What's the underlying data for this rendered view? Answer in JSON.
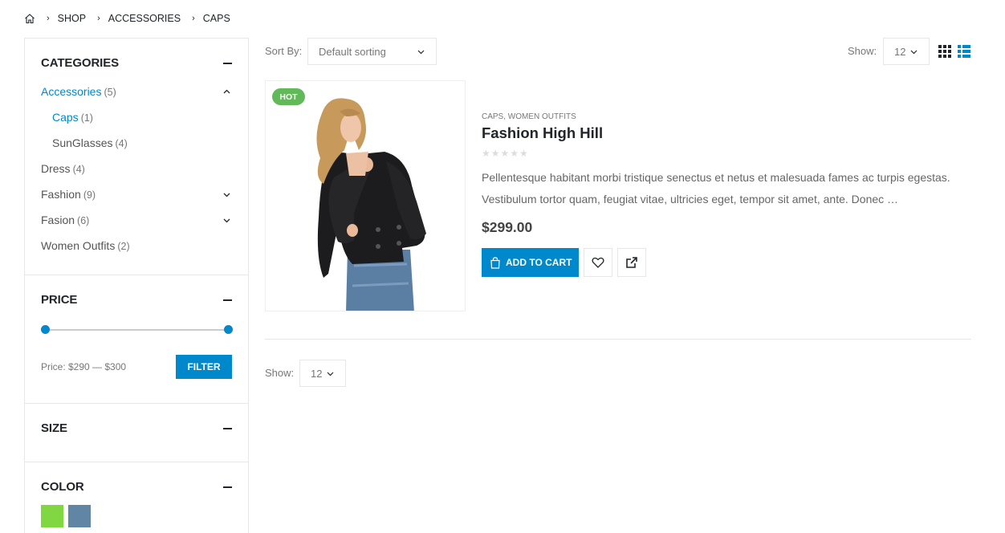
{
  "breadcrumb": {
    "home_icon": "home-icon",
    "items": [
      "SHOP",
      "ACCESSORIES",
      "CAPS"
    ]
  },
  "sidebar": {
    "categories": {
      "title": "CATEGORIES",
      "items": [
        {
          "name": "Accessories",
          "count": "(5)",
          "active": true,
          "expanded": true
        },
        {
          "name": "Caps",
          "count": "(1)",
          "active": true,
          "child": true
        },
        {
          "name": "SunGlasses",
          "count": "(4)",
          "child": true
        },
        {
          "name": "Dress",
          "count": "(4)"
        },
        {
          "name": "Fashion",
          "count": "(9)",
          "collapsible": true
        },
        {
          "name": "Fasion",
          "count": "(6)",
          "collapsible": true
        },
        {
          "name": "Women Outfits",
          "count": "(2)"
        }
      ]
    },
    "price": {
      "title": "PRICE",
      "label": "Price: $290 — $300",
      "filter_label": "FILTER",
      "range_min_fraction": 0,
      "range_max_fraction": 1
    },
    "size": {
      "title": "SIZE"
    },
    "color": {
      "title": "COLOR",
      "swatches": [
        "#81d742",
        "#6085a5"
      ]
    }
  },
  "toolbar": {
    "sort_label": "Sort By:",
    "sort_value": "Default sorting",
    "show_label": "Show:",
    "show_value": "12"
  },
  "product": {
    "badge": "HOT",
    "categories": "CAPS, WOMEN OUTFITS",
    "title": "Fashion High Hill",
    "rating_stars": "★★★★★",
    "description": "Pellentesque habitant morbi tristique senectus et netus et malesuada fames ac turpis egestas. Vestibulum tortor quam, feugiat vitae, ultricies eget, tempor sit amet, ante. Donec …",
    "price": "$299.00",
    "add_to_cart": "ADD TO CART"
  },
  "bottom": {
    "show_label": "Show:",
    "show_value": "12"
  },
  "colors": {
    "accent": "#0088cc",
    "badge_hot": "#62b959"
  }
}
